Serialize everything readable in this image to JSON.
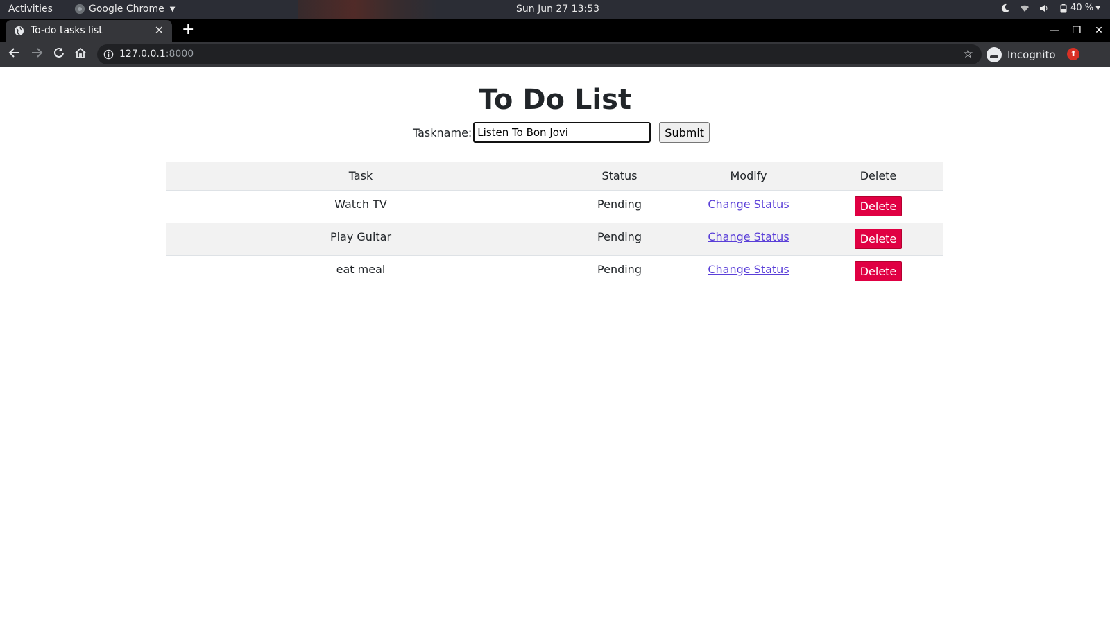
{
  "system_bar": {
    "activities": "Activities",
    "app_name": "Google Chrome",
    "clock": "Sun Jun 27  13:53",
    "battery": "40 %"
  },
  "browser": {
    "tab_title": "To-do tasks list",
    "url_host": "127.0.0.1",
    "url_port": ":8000",
    "incognito_label": "Incognito"
  },
  "page": {
    "title": "To Do List",
    "form": {
      "label": "Taskname:",
      "input_value": "Listen To Bon Jovi",
      "submit_label": "Submit"
    },
    "table": {
      "headers": [
        "Task",
        "Status",
        "Modify",
        "Delete"
      ],
      "rows": [
        {
          "task": "Watch TV",
          "status": "Pending",
          "modify": "Change Status",
          "delete": "Delete"
        },
        {
          "task": "Play Guitar",
          "status": "Pending",
          "modify": "Change Status",
          "delete": "Delete"
        },
        {
          "task": "eat meal",
          "status": "Pending",
          "modify": "Change Status",
          "delete": "Delete"
        }
      ]
    }
  }
}
